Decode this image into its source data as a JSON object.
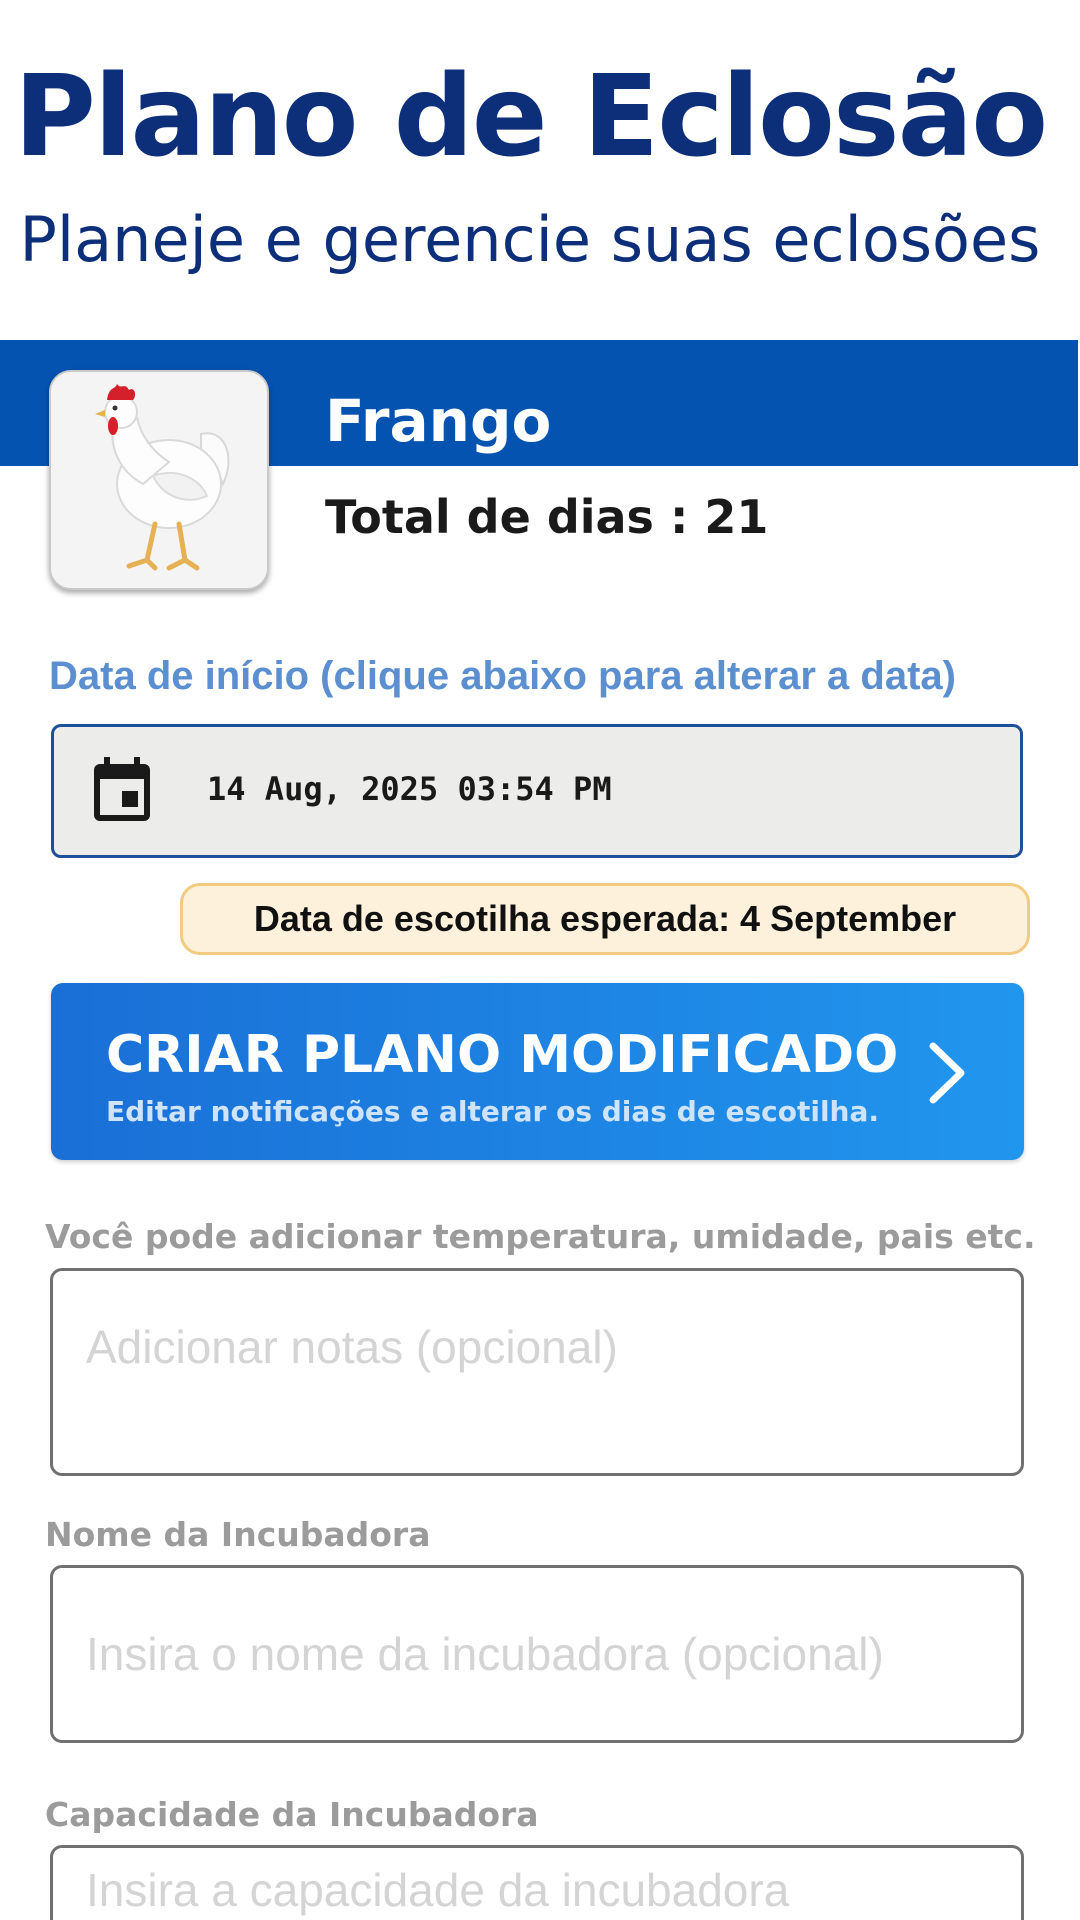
{
  "header": {
    "title": "Plano de Eclosão",
    "subtitle": "Planeje e gerencie suas eclosões"
  },
  "species": {
    "name": "Frango",
    "total_days": "Total de dias : 21",
    "image_icon": "chicken-photo"
  },
  "start_date": {
    "label": "Data de início (clique abaixo para alterar a data)",
    "icon": "calendar-icon",
    "value": "14 Aug, 2025 03:54 PM"
  },
  "hatch": {
    "expected_label": "Data de escotilha esperada: 4 September"
  },
  "custom_plan": {
    "title": "CRIAR PLANO MODIFICADO",
    "subtitle": "Editar notificações e alterar os dias de escotilha.",
    "icon": "chevron-right-icon"
  },
  "notes": {
    "caption": "Você pode adicionar temperatura, umidade, pais etc.",
    "value": "",
    "placeholder": "Adicionar notas (opcional)"
  },
  "incubator_name": {
    "caption": "Nome da Incubadora",
    "value": "",
    "placeholder": "Insira o nome da incubadora (opcional)"
  },
  "incubator_capacity": {
    "caption": "Capacidade da Incubadora",
    "value": "",
    "placeholder": "Insira a capacidade da incubadora"
  },
  "colors": {
    "primary_dark": "#0d2f7a",
    "band_blue": "#0553b1",
    "button_gradient_start": "#1a6fd6",
    "button_gradient_end": "#2196ee",
    "label_blue": "#5b8fd0",
    "badge_bg": "#fdf1dc",
    "badge_border": "#f2cb82"
  }
}
